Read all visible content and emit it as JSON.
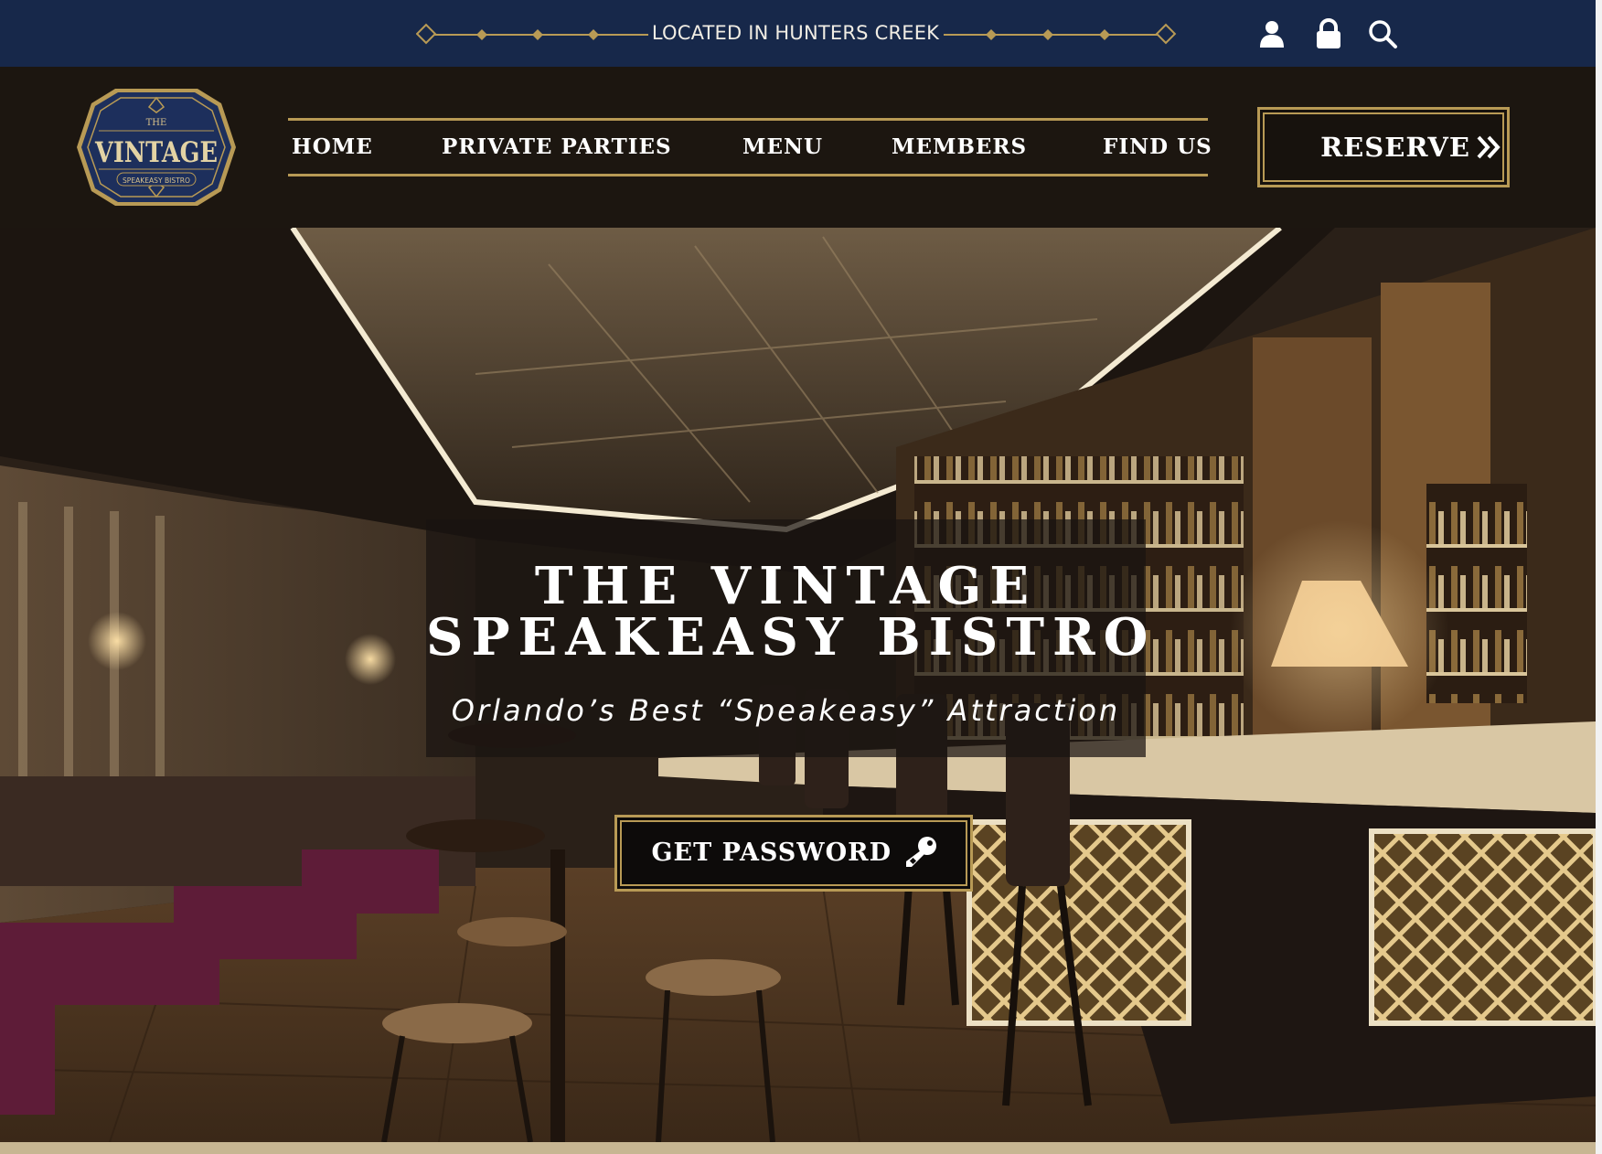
{
  "topbar": {
    "location": "LOCATED IN HUNTERS CREEK",
    "icons": [
      "user-icon",
      "lock-icon",
      "search-icon"
    ]
  },
  "logo": {
    "small_top": "THE",
    "main": "VINTAGE",
    "small_bottom": "SPEAKEASY BISTRO"
  },
  "nav": {
    "items": [
      {
        "label": "HOME"
      },
      {
        "label": "PRIVATE PARTIES"
      },
      {
        "label": "MENU"
      },
      {
        "label": "MEMBERS"
      },
      {
        "label": "FIND US"
      }
    ],
    "reserve_label": "RESERVE"
  },
  "hero": {
    "title_line1": "THE VINTAGE",
    "title_line2": "SPEAKEASY BISTRO",
    "tagline": "Orlando’s Best “Speakeasy” Attraction",
    "password_label": "GET PASSWORD"
  },
  "colors": {
    "topbar_bg": "#17284a",
    "nav_bg": "#1c1610",
    "gold": "#b89a55",
    "logo_navy": "#1d2f5c"
  }
}
